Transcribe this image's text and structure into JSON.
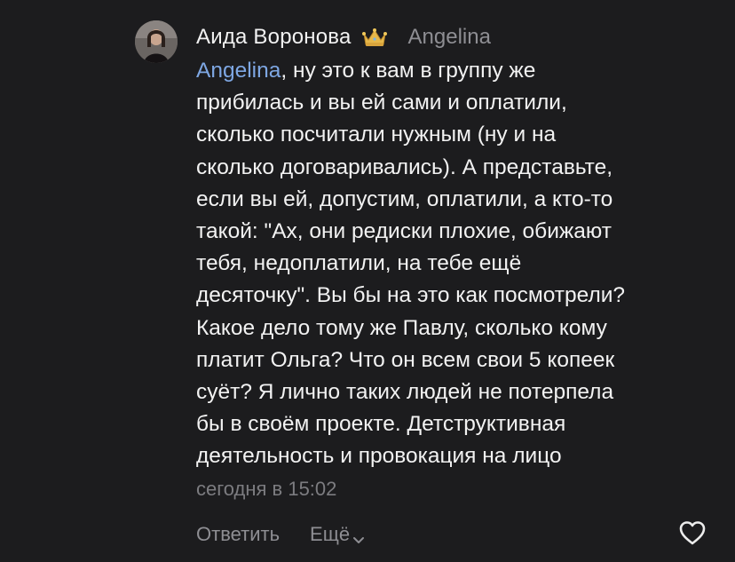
{
  "comment": {
    "author": "Аида Воронова",
    "badge_icon": "crown-icon",
    "reply_to": "Angelina",
    "mention": "Angelina",
    "text_lines": [
      ", ну это к вам в группу же",
      "прибилась и вы ей сами и оплатили,",
      "сколько посчитали нужным (ну и на",
      "сколько договаривались). А представьте,",
      "если вы ей, допустим, оплатили, а кто-то",
      "такой: \"Ах, они редиски плохие, обижают",
      "тебя, недоплатили, на тебе ещё",
      "десяточку\". Вы бы на это как посмотрели?",
      "Какое дело тому же Павлу, сколько кому",
      "платит Ольга? Что он всем свои 5 копеек",
      "суёт? Я лично таких людей не потерпела",
      "бы в своём проекте. Детструктивная",
      "деятельность и провокация на лицо"
    ],
    "timestamp": "сегодня в 15:02"
  },
  "actions": {
    "reply_label": "Ответить",
    "more_label": "Ещё",
    "more_icon": "chevron-down-icon",
    "like_icon": "heart-outline-icon"
  },
  "colors": {
    "background": "#1c1c1e",
    "text": "#f2f2f2",
    "secondary": "#8e8e93",
    "mention": "#7ea7e3"
  }
}
